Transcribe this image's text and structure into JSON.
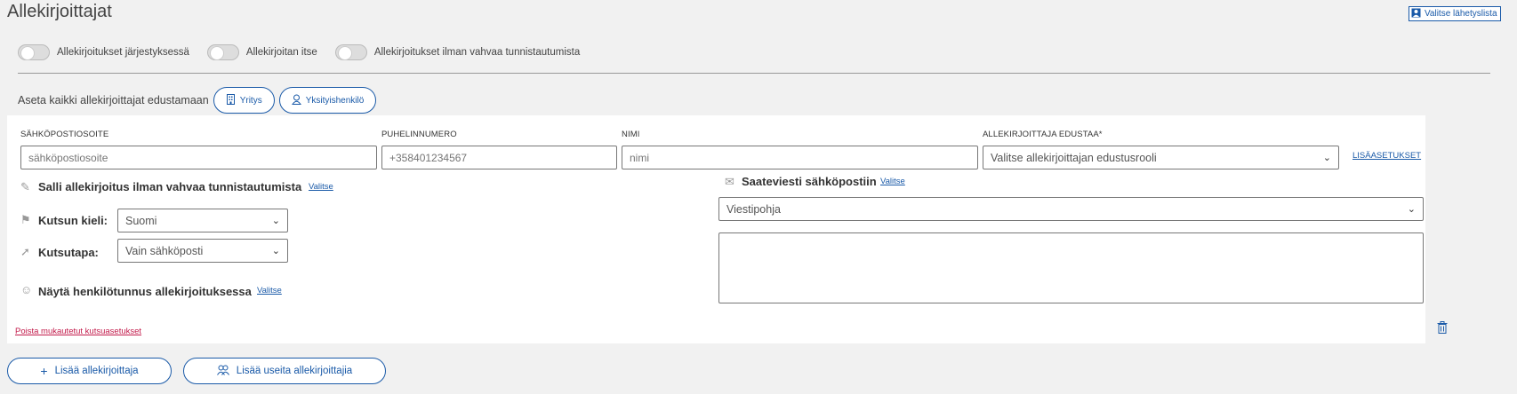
{
  "header": {
    "title": "Allekirjoittajat",
    "mailing_list_button": "Valitse lähetyslista"
  },
  "toggles": [
    {
      "label": "Allekirjoitukset järjestyksessä"
    },
    {
      "label": "Allekirjoitan itse"
    },
    {
      "label": "Allekirjoitukset ilman vahvaa tunnistautumista"
    }
  ],
  "representation": {
    "label": "Aseta kaikki allekirjoittajat edustamaan",
    "company_button": "Yritys",
    "private_button": "Yksityishenkilö"
  },
  "signer": {
    "email_label": "SÄHKÖPOSTIOSOITE",
    "email_placeholder": "sähköpostiosoite",
    "phone_label": "PUHELINNUMERO",
    "phone_placeholder": "+358401234567",
    "name_label": "NIMI",
    "name_placeholder": "nimi",
    "role_label": "ALLEKIRJOITTAJA EDUSTAA*",
    "role_value": "Valitse allekirjoittajan edustusrooli",
    "more_settings": "LISÄASETUKSET",
    "allow_weak_label": "Salli allekirjoitus ilman vahvaa tunnistautumista",
    "allow_weak_link": "Valitse",
    "language_label": "Kutsun kieli:",
    "language_value": "Suomi",
    "method_label": "Kutsutapa:",
    "method_value": "Vain sähköposti",
    "show_id_label": "Näytä henkilötunnus allekirjoituksessa",
    "show_id_link": "Valitse",
    "cover_label": "Saateviesti sähköpostiin",
    "cover_link": "Valitse",
    "template_value": "Viestipohja",
    "remove_custom": "Poista mukautetut kutsuasetukset"
  },
  "actions": {
    "add_signer": "Lisää allekirjoittaja",
    "add_multiple": "Lisää useita allekirjoittajia"
  }
}
